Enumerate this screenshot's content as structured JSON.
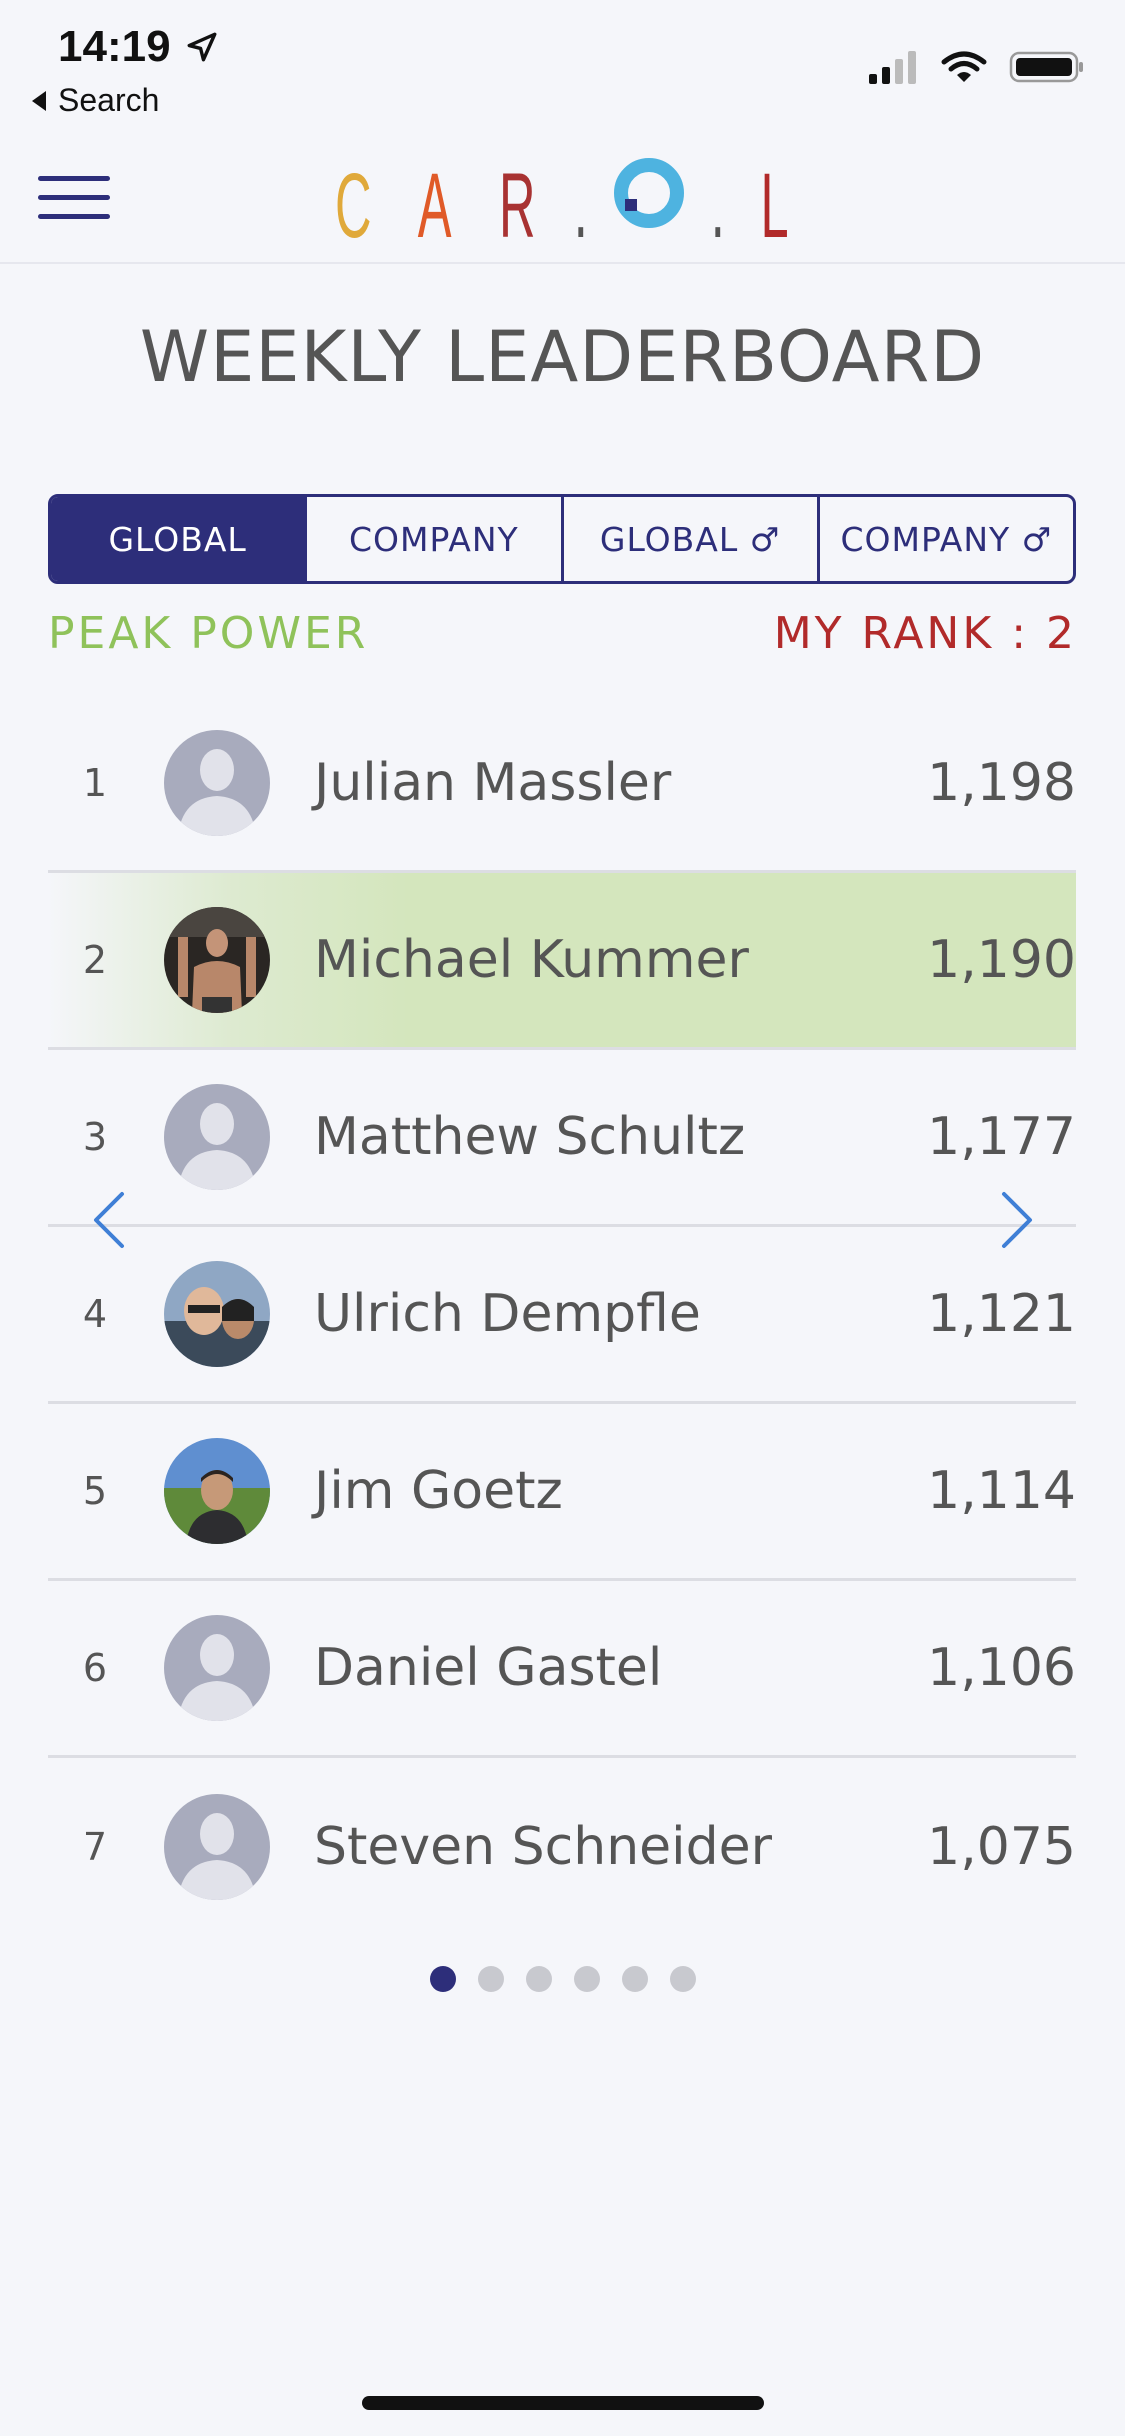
{
  "status": {
    "time": "14:19",
    "back_label": "Search"
  },
  "app": {
    "logo_letters": [
      {
        "char": "C",
        "color": "#e0a93a"
      },
      {
        "char": "A",
        "color": "#e05a28"
      },
      {
        "char": "R",
        "color": "#a83232"
      },
      {
        "char": ".",
        "color": "#555555"
      },
      {
        "char": "O",
        "color": "#4eb3e0"
      },
      {
        "char": ".",
        "color": "#555555"
      },
      {
        "char": "L",
        "color": "#b12a2a"
      }
    ]
  },
  "page": {
    "title": "WEEKLY LEADERBOARD"
  },
  "tabs": [
    {
      "label": "GLOBAL",
      "active": true
    },
    {
      "label": "COMPANY",
      "active": false
    },
    {
      "label": "GLOBAL ♂",
      "active": false
    },
    {
      "label": "COMPANY ♂",
      "active": false
    }
  ],
  "metric_label": "PEAK POWER",
  "my_rank_label": "MY RANK : 2",
  "leaderboard": [
    {
      "rank": "1",
      "name": "Julian Massler",
      "score": "1,198",
      "avatar": "placeholder"
    },
    {
      "rank": "2",
      "name": "Michael Kummer",
      "score": "1,190",
      "avatar": "photo",
      "is_me": true
    },
    {
      "rank": "3",
      "name": "Matthew Schultz",
      "score": "1,177",
      "avatar": "placeholder"
    },
    {
      "rank": "4",
      "name": "Ulrich Dempfle",
      "score": "1,121",
      "avatar": "photo"
    },
    {
      "rank": "5",
      "name": "Jim Goetz",
      "score": "1,114",
      "avatar": "photo"
    },
    {
      "rank": "6",
      "name": "Daniel Gastel",
      "score": "1,106",
      "avatar": "placeholder"
    },
    {
      "rank": "7",
      "name": "Steven Schneider",
      "score": "1,075",
      "avatar": "placeholder"
    }
  ],
  "pagination": {
    "pages": 6,
    "current": 1
  },
  "colors": {
    "primary": "#2d2e7a",
    "metric": "#8fc25a",
    "rank": "#b12a2a",
    "highlight": "#d4e6bd",
    "arrow": "#3f7fd6"
  },
  "icons": [
    "location-arrow-icon",
    "back-caret-icon",
    "signal-icon",
    "wifi-icon",
    "battery-icon",
    "hamburger-menu-icon",
    "chevron-left-icon",
    "chevron-right-icon",
    "person-placeholder-icon"
  ]
}
